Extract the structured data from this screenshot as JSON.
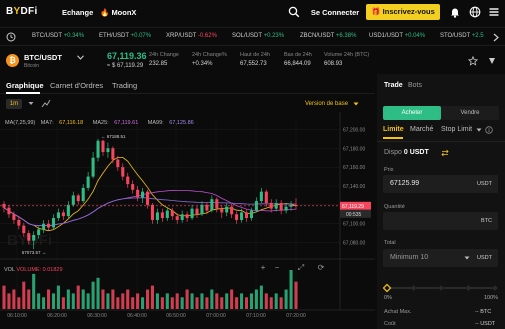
{
  "nav": {
    "logo_main": "B",
    "logo_accent": "Y",
    "logo_rest": "DFi",
    "exchange": "Echange",
    "moonx": "MoonX",
    "login": "Se Connecter",
    "signup": "Inscrivez-vous"
  },
  "ticker": [
    {
      "symbol": "BTC/USDT",
      "change": "+0.34%",
      "dir": "up"
    },
    {
      "symbol": "ETH/USDT",
      "change": "+0.07%",
      "dir": "up"
    },
    {
      "symbol": "XRP/USDT",
      "change": "-0.62%",
      "dir": "down"
    },
    {
      "symbol": "SOL/USDT",
      "change": "+0.23%",
      "dir": "up"
    },
    {
      "symbol": "ZBCN/USDT",
      "change": "+6.38%",
      "dir": "up"
    },
    {
      "symbol": "USD1/USDT",
      "change": "+0.04%",
      "dir": "up"
    },
    {
      "symbol": "STO/USDT",
      "change": "+2.5",
      "dir": "up"
    }
  ],
  "market": {
    "pair": "BTC/USDT",
    "coin": "Bitcoin",
    "coin_glyph": "₿",
    "last_price": "67,119.36",
    "last_usd": "≈ $ 67,119.29",
    "stats": [
      {
        "label": "24h Change",
        "value": "232.85",
        "color": "green"
      },
      {
        "label": "24h Change%",
        "value": "+0.34%",
        "color": "green"
      },
      {
        "label": "Haut de 24h",
        "value": "67,552.73",
        "color": "plain"
      },
      {
        "label": "Bas de 24h",
        "value": "66,844.09",
        "color": "plain"
      },
      {
        "label": "Volume 24h (BTC)",
        "value": "608.93",
        "color": "plain"
      }
    ]
  },
  "tabs": [
    "Graphique",
    "Carnet d'Ordres",
    "Trading"
  ],
  "toolbar": {
    "timeframe": "1m",
    "version": "Version de base"
  },
  "ma_legend": {
    "ma_label": "MA(7,25,99)",
    "ma7_label": "MA7:",
    "ma7": "67,116.18",
    "ma25_label": "MA25:",
    "ma25": "67,119.61",
    "ma99_label": "MA99:",
    "ma99": "67,125.86"
  },
  "vol_legend": {
    "label": "VOL",
    "volume_label": "VOLUME:",
    "volume": "0.01829"
  },
  "vol_tools": [
    "+",
    "−",
    "⤢",
    "⟳"
  ],
  "watermark": "BYDFi",
  "chart_data": {
    "type": "candlestick",
    "y_ticks": [
      "67,200.00",
      "67,180.00",
      "67,160.00",
      "67,140.00",
      "67,120.00",
      "67,100.00",
      "67,080.00"
    ],
    "x_ticks": [
      "06:10:00",
      "06:20:00",
      "06:30:00",
      "06:40:00",
      "06:50:00",
      "07:00:00",
      "07:10:00",
      "07:20:00"
    ],
    "ylim": [
      67070,
      67210
    ],
    "last_price_label": "67,119.29",
    "countdown": "00:535",
    "high_label": "67188.51",
    "low_label": "67073.57",
    "candles": [
      [
        67121,
        67117,
        67124,
        67112
      ],
      [
        67117,
        67110,
        67120,
        67106
      ],
      [
        67110,
        67104,
        67113,
        67100
      ],
      [
        67104,
        67098,
        67108,
        67094
      ],
      [
        67098,
        67090,
        67101,
        67086
      ],
      [
        67090,
        67082,
        67093,
        67078
      ],
      [
        67082,
        67088,
        67092,
        67073
      ],
      [
        67088,
        67094,
        67097,
        67084
      ],
      [
        67094,
        67100,
        67104,
        67090
      ],
      [
        67100,
        67096,
        67104,
        67093
      ],
      [
        67096,
        67106,
        67110,
        67094
      ],
      [
        67106,
        67112,
        67116,
        67103
      ],
      [
        67112,
        67108,
        67115,
        67104
      ],
      [
        67108,
        67120,
        67124,
        67106
      ],
      [
        67120,
        67130,
        67134,
        67118
      ],
      [
        67130,
        67124,
        67132,
        67120
      ],
      [
        67124,
        67138,
        67142,
        67122
      ],
      [
        67138,
        67150,
        67155,
        67135
      ],
      [
        67150,
        67170,
        67176,
        67148
      ],
      [
        67170,
        67188,
        67190,
        67166
      ],
      [
        67188,
        67176,
        67189,
        67172
      ],
      [
        67176,
        67180,
        67186,
        67170
      ],
      [
        67180,
        67168,
        67182,
        67164
      ],
      [
        67168,
        67160,
        67172,
        67156
      ],
      [
        67160,
        67150,
        67164,
        67146
      ],
      [
        67150,
        67142,
        67154,
        67138
      ],
      [
        67142,
        67136,
        67146,
        67132
      ],
      [
        67136,
        67128,
        67140,
        67124
      ],
      [
        67128,
        67134,
        67138,
        67122
      ],
      [
        67134,
        67120,
        67136,
        67116
      ],
      [
        67120,
        67104,
        67122,
        67100
      ],
      [
        67104,
        67112,
        67116,
        67100
      ],
      [
        67112,
        67106,
        67116,
        67102
      ],
      [
        67106,
        67114,
        67118,
        67103
      ],
      [
        67114,
        67108,
        67117,
        67104
      ],
      [
        67108,
        67104,
        67111,
        67100
      ],
      [
        67104,
        67110,
        67114,
        67101
      ],
      [
        67110,
        67106,
        67113,
        67102
      ],
      [
        67106,
        67116,
        67120,
        67104
      ],
      [
        67116,
        67110,
        67119,
        67106
      ],
      [
        67110,
        67120,
        67124,
        67108
      ],
      [
        67120,
        67114,
        67123,
        67110
      ],
      [
        67114,
        67126,
        67130,
        67112
      ],
      [
        67126,
        67116,
        67128,
        67112
      ],
      [
        67116,
        67112,
        67120,
        67106
      ],
      [
        67112,
        67118,
        67122,
        67108
      ],
      [
        67118,
        67110,
        67121,
        67106
      ],
      [
        67110,
        67104,
        67113,
        67100
      ],
      [
        67104,
        67112,
        67116,
        67101
      ],
      [
        67112,
        67106,
        67115,
        67102
      ],
      [
        67106,
        67114,
        67117,
        67103
      ],
      [
        67114,
        67124,
        67128,
        67112
      ],
      [
        67124,
        67134,
        67138,
        67122
      ],
      [
        67134,
        67122,
        67136,
        67118
      ],
      [
        67122,
        67116,
        67126,
        67112
      ],
      [
        67116,
        67122,
        67126,
        67113
      ],
      [
        67122,
        67114,
        67125,
        67110
      ],
      [
        67114,
        67118,
        67122,
        67111
      ],
      [
        67118,
        67120,
        67124,
        67114
      ],
      [
        67120,
        67119,
        67127,
        67115
      ]
    ],
    "volumes": [
      0.6,
      0.4,
      0.5,
      0.3,
      0.7,
      0.5,
      0.9,
      0.4,
      0.3,
      0.5,
      0.4,
      0.6,
      0.3,
      0.5,
      0.4,
      0.6,
      0.5,
      0.4,
      0.7,
      0.8,
      0.5,
      0.4,
      0.5,
      0.3,
      0.4,
      0.5,
      0.3,
      0.4,
      0.3,
      0.5,
      0.6,
      0.4,
      0.3,
      0.4,
      0.3,
      0.4,
      0.3,
      0.5,
      0.4,
      0.3,
      0.4,
      0.3,
      0.5,
      0.4,
      0.3,
      0.4,
      0.5,
      0.3,
      0.4,
      0.3,
      0.4,
      0.5,
      0.6,
      0.4,
      0.3,
      0.4,
      0.3,
      0.5,
      1.0,
      0.7
    ]
  },
  "trade_panel": {
    "tabs": [
      "Trade",
      "Bots"
    ],
    "buy": "Acheter",
    "sell": "Vendre",
    "order_types": [
      "Limite",
      "Marché",
      "Stop Limit"
    ],
    "dispo_label": "Dispo",
    "dispo_value": "0 USDT",
    "price_label": "Prix",
    "price_value": "67125.99",
    "price_unit": "USDT",
    "qty_label": "Quantité",
    "qty_value": "",
    "qty_unit": "BTC",
    "total_label": "Total",
    "total_value": "Minimum 10",
    "total_unit": "USDT",
    "slider_min": "0%",
    "slider_max": "100%",
    "max_buy_label": "Achat Max.",
    "max_buy_value": "-- BTC",
    "cost_label": "Coût",
    "cost_value": "-- USDT"
  },
  "colors": {
    "up": "#2ebd85",
    "down": "#f6465d",
    "accent": "#f3c316",
    "ma7": "#f3c316",
    "ma25": "#c04fd0",
    "ma99": "#8a6dd8"
  }
}
